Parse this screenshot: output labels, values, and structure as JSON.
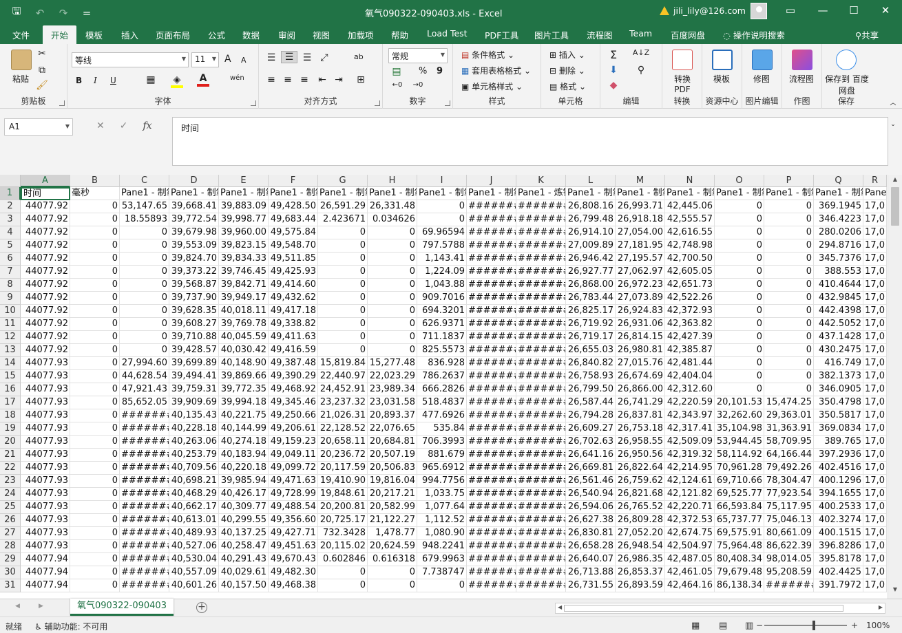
{
  "titlebar": {
    "save_glyph": "🖫",
    "undo_glyph": "↶",
    "redo_glyph": "↷",
    "qat_more": "=",
    "title": "氧气090322-090403.xls  -  Excel",
    "account": "jili_lily@126.com",
    "min": "—",
    "restore": "▭",
    "max": "☐",
    "close": "✕"
  },
  "tabs": [
    "文件",
    "开始",
    "模板",
    "插入",
    "页面布局",
    "公式",
    "数据",
    "审阅",
    "视图",
    "加载项",
    "帮助",
    "Load Test",
    "PDF工具",
    "图片工具",
    "流程图",
    "Team",
    "百度网盘"
  ],
  "tell_me": "操作说明搜索",
  "share": "共享",
  "ribbon": {
    "clipboard": {
      "label": "剪贴板",
      "paste": "粘贴"
    },
    "font": {
      "label": "字体",
      "name": "等线",
      "size": "11",
      "bold": "B",
      "italic": "I",
      "underline": "U",
      "grow": "A",
      "shrink": "A",
      "wen": "wén"
    },
    "align": {
      "label": "对齐方式",
      "wrap": "ab"
    },
    "number": {
      "label": "数字",
      "format": "常规",
      "percent": "%",
      "comma": "9"
    },
    "styles": {
      "label": "样式",
      "cond": "条件格式",
      "table": "套用表格格式",
      "cell": "单元格样式"
    },
    "cells": {
      "label": "单元格",
      "insert": "插入",
      "delete": "删除",
      "format": "格式"
    },
    "editing": {
      "label": "编辑"
    },
    "convert": {
      "label": "转换",
      "btn": "转换 PDF"
    },
    "resource": {
      "label": "资源中心",
      "btn": "模板"
    },
    "picedit": {
      "label": "图片编辑",
      "btn": "修图"
    },
    "draw": {
      "label": "作图",
      "btn": "流程图"
    },
    "save": {
      "label": "保存",
      "btn": "保存到 百度网盘"
    }
  },
  "formula": {
    "namebox": "A1",
    "content": "时间",
    "cancel": "✕",
    "enter": "✓",
    "fx": "fx"
  },
  "columns": [
    "A",
    "B",
    "C",
    "D",
    "E",
    "F",
    "G",
    "H",
    "I",
    "J",
    "K",
    "L",
    "M",
    "N",
    "O",
    "P",
    "Q",
    "R"
  ],
  "rows": [
    [
      "时间",
      "毫秒",
      "Pane1 - 制氧",
      "Pane1 - 制氧",
      "Pane1 - 制氧",
      "Pane1 - 制氧",
      "Pane1 - 制氧",
      "Pane1 - 制氧",
      "Pane1 - 制氧",
      "Pane1 - 制氧",
      "Pane1 - 炼钢",
      "Pane1 - 制氧",
      "Pane1 - 制氧",
      "Pane1 - 制氧",
      "Pane1 - 制氧",
      "Pane1 - 制氧",
      "Pane1 - 制氧",
      "Pane"
    ],
    [
      "44077.92",
      "0",
      "53,147.65",
      "39,668.41",
      "39,883.09",
      "49,428.50",
      "26,591.29",
      "26,331.48",
      "0",
      "#######",
      "#######",
      "26,808.16",
      "26,993.71",
      "42,445.06",
      "0",
      "0",
      "369.1945",
      "17,0"
    ],
    [
      "44077.92",
      "0",
      "18.55893",
      "39,772.54",
      "39,998.77",
      "49,683.44",
      "2.423671",
      "0.034626",
      "0",
      "#######",
      "#######",
      "26,799.48",
      "26,918.18",
      "42,555.57",
      "0",
      "0",
      "346.4223",
      "17,0"
    ],
    [
      "44077.92",
      "0",
      "0",
      "39,679.98",
      "39,960.00",
      "49,575.84",
      "0",
      "0",
      "69.96594",
      "#######",
      "#######",
      "26,914.10",
      "27,054.00",
      "42,616.55",
      "0",
      "0",
      "280.0206",
      "17,0"
    ],
    [
      "44077.92",
      "0",
      "0",
      "39,553.09",
      "39,823.15",
      "49,548.70",
      "0",
      "0",
      "797.5788",
      "#######",
      "#######",
      "27,009.89",
      "27,181.95",
      "42,748.98",
      "0",
      "0",
      "294.8716",
      "17,0"
    ],
    [
      "44077.92",
      "0",
      "0",
      "39,824.70",
      "39,834.33",
      "49,511.85",
      "0",
      "0",
      "1,143.41",
      "#######",
      "#######",
      "26,946.42",
      "27,195.57",
      "42,700.50",
      "0",
      "0",
      "345.7376",
      "17,0"
    ],
    [
      "44077.92",
      "0",
      "0",
      "39,373.22",
      "39,746.45",
      "49,425.93",
      "0",
      "0",
      "1,224.09",
      "#######",
      "#######",
      "26,927.77",
      "27,062.97",
      "42,605.05",
      "0",
      "0",
      "388.553",
      "17,0"
    ],
    [
      "44077.92",
      "0",
      "0",
      "39,568.87",
      "39,842.71",
      "49,414.60",
      "0",
      "0",
      "1,043.88",
      "#######",
      "#######",
      "26,868.00",
      "26,972.23",
      "42,651.73",
      "0",
      "0",
      "410.4644",
      "17,0"
    ],
    [
      "44077.92",
      "0",
      "0",
      "39,737.90",
      "39,949.17",
      "49,432.62",
      "0",
      "0",
      "909.7016",
      "#######",
      "#######",
      "26,783.44",
      "27,073.89",
      "42,522.26",
      "0",
      "0",
      "432.9845",
      "17,0"
    ],
    [
      "44077.92",
      "0",
      "0",
      "39,628.35",
      "40,018.11",
      "49,417.18",
      "0",
      "0",
      "694.3201",
      "#######",
      "#######",
      "26,825.17",
      "26,924.83",
      "42,372.93",
      "0",
      "0",
      "442.4398",
      "17,0"
    ],
    [
      "44077.92",
      "0",
      "0",
      "39,608.27",
      "39,769.78",
      "49,338.82",
      "0",
      "0",
      "626.9371",
      "#######",
      "#######",
      "26,719.92",
      "26,931.06",
      "42,363.82",
      "0",
      "0",
      "442.5052",
      "17,0"
    ],
    [
      "44077.92",
      "0",
      "0",
      "39,710.88",
      "40,045.59",
      "49,411.63",
      "0",
      "0",
      "711.1837",
      "#######",
      "#######",
      "26,719.17",
      "26,814.15",
      "42,427.39",
      "0",
      "0",
      "437.1428",
      "17,0"
    ],
    [
      "44077.92",
      "0",
      "0",
      "39,428.57",
      "40,030.42",
      "49,416.59",
      "0",
      "0",
      "825.5573",
      "#######",
      "#######",
      "26,655.03",
      "26,980.81",
      "42,385.87",
      "0",
      "0",
      "430.2475",
      "17,0"
    ],
    [
      "44077.93",
      "0",
      "27,994.60",
      "39,699.89",
      "40,148.90",
      "49,387.48",
      "15,819.84",
      "15,277.48",
      "836.928",
      "#######",
      "#######",
      "26,840.82",
      "27,015.76",
      "42,481.44",
      "0",
      "0",
      "416.749",
      "17,0"
    ],
    [
      "44077.93",
      "0",
      "44,628.54",
      "39,494.41",
      "39,869.66",
      "49,390.29",
      "22,440.97",
      "22,023.29",
      "786.2637",
      "#######",
      "#######",
      "26,758.93",
      "26,674.69",
      "42,404.04",
      "0",
      "0",
      "382.1373",
      "17,0"
    ],
    [
      "44077.93",
      "0",
      "47,921.43",
      "39,759.31",
      "39,772.35",
      "49,468.92",
      "24,452.91",
      "23,989.34",
      "666.2826",
      "#######",
      "#######",
      "26,799.50",
      "26,866.00",
      "42,312.60",
      "0",
      "0",
      "346.0905",
      "17,0"
    ],
    [
      "44077.93",
      "0",
      "85,652.05",
      "39,909.69",
      "39,994.18",
      "49,345.46",
      "23,237.32",
      "23,031.58",
      "518.4837",
      "#######",
      "#######",
      "26,587.44",
      "26,741.29",
      "42,220.59",
      "20,101.53",
      "15,474.25",
      "350.4798",
      "17,0"
    ],
    [
      "44077.93",
      "0",
      "#######",
      "40,135.43",
      "40,221.75",
      "49,250.66",
      "21,026.31",
      "20,893.37",
      "477.6926",
      "#######",
      "#######",
      "26,794.28",
      "26,837.81",
      "42,343.97",
      "32,262.60",
      "29,363.01",
      "350.5817",
      "17,0"
    ],
    [
      "44077.93",
      "0",
      "#######",
      "40,228.18",
      "40,144.99",
      "49,206.61",
      "22,128.52",
      "22,076.65",
      "535.84",
      "#######",
      "#######",
      "26,609.27",
      "26,753.18",
      "42,317.41",
      "35,104.98",
      "31,363.91",
      "369.0834",
      "17,0"
    ],
    [
      "44077.93",
      "0",
      "#######",
      "40,263.06",
      "40,274.18",
      "49,159.23",
      "20,658.11",
      "20,684.81",
      "706.3993",
      "#######",
      "#######",
      "26,702.63",
      "26,958.55",
      "42,509.09",
      "53,944.45",
      "58,709.95",
      "389.765",
      "17,0"
    ],
    [
      "44077.93",
      "0",
      "#######",
      "40,253.79",
      "40,183.94",
      "49,049.11",
      "20,236.72",
      "20,507.19",
      "881.679",
      "#######",
      "#######",
      "26,641.16",
      "26,950.56",
      "42,319.32",
      "58,114.92",
      "64,166.44",
      "397.2936",
      "17,0"
    ],
    [
      "44077.93",
      "0",
      "#######",
      "40,709.56",
      "40,220.18",
      "49,099.72",
      "20,117.59",
      "20,506.83",
      "965.6912",
      "#######",
      "#######",
      "26,669.81",
      "26,822.64",
      "42,214.95",
      "70,961.28",
      "79,492.26",
      "402.4516",
      "17,0"
    ],
    [
      "44077.93",
      "0",
      "#######",
      "40,698.21",
      "39,985.94",
      "49,471.63",
      "19,410.90",
      "19,816.04",
      "994.7756",
      "#######",
      "#######",
      "26,561.46",
      "26,759.62",
      "42,124.61",
      "69,710.66",
      "78,304.47",
      "400.1296",
      "17,0"
    ],
    [
      "44077.93",
      "0",
      "#######",
      "40,468.29",
      "40,426.17",
      "49,728.99",
      "19,848.61",
      "20,217.21",
      "1,033.75",
      "#######",
      "#######",
      "26,540.94",
      "26,821.68",
      "42,121.82",
      "69,525.77",
      "77,923.54",
      "394.1655",
      "17,0"
    ],
    [
      "44077.93",
      "0",
      "#######",
      "40,662.17",
      "40,309.77",
      "49,488.54",
      "20,200.81",
      "20,582.99",
      "1,077.64",
      "#######",
      "#######",
      "26,594.06",
      "26,765.52",
      "42,220.71",
      "66,593.84",
      "75,117.95",
      "400.2533",
      "17,0"
    ],
    [
      "44077.93",
      "0",
      "#######",
      "40,613.01",
      "40,299.55",
      "49,356.60",
      "20,725.17",
      "21,122.27",
      "1,112.52",
      "#######",
      "#######",
      "26,627.38",
      "26,809.28",
      "42,372.53",
      "65,737.77",
      "75,046.13",
      "402.3274",
      "17,0"
    ],
    [
      "44077.93",
      "0",
      "#######",
      "40,489.93",
      "40,137.25",
      "49,427.71",
      "732.3428",
      "1,478.77",
      "1,080.90",
      "#######",
      "#######",
      "26,830.81",
      "27,052.20",
      "42,674.75",
      "69,575.91",
      "80,661.09",
      "400.1515",
      "17,0"
    ],
    [
      "44077.93",
      "0",
      "#######",
      "40,527.06",
      "40,258.47",
      "49,451.63",
      "20,115.02",
      "20,624.59",
      "948.2241",
      "#######",
      "#######",
      "26,658.28",
      "26,948.54",
      "42,504.97",
      "75,964.48",
      "86,622.39",
      "396.8286",
      "17,0"
    ],
    [
      "44077.94",
      "0",
      "#######",
      "40,530.04",
      "40,291.43",
      "49,670.43",
      "0.602846",
      "0.616318",
      "679.9963",
      "#######",
      "#######",
      "26,640.07",
      "26,986.35",
      "42,487.05",
      "80,408.34",
      "98,014.05",
      "395.8178",
      "17,0"
    ],
    [
      "44077.94",
      "0",
      "#######",
      "40,557.09",
      "40,029.61",
      "49,482.30",
      "0",
      "0",
      "7.738747",
      "#######",
      "#######",
      "26,713.88",
      "26,853.37",
      "42,461.05",
      "79,679.48",
      "95,208.59",
      "402.4425",
      "17,0"
    ],
    [
      "44077.94",
      "0",
      "#######",
      "40,601.26",
      "40,157.50",
      "49,468.38",
      "0",
      "0",
      "0",
      "#######",
      "#######",
      "26,731.55",
      "26,893.59",
      "42,464.16",
      "86,138.34",
      "#######",
      "391.7972",
      "17,0"
    ]
  ],
  "sheet": {
    "name": "氧气090322-090403",
    "add": "+",
    "prev": "◀",
    "next": "▶"
  },
  "status": {
    "ready": "就绪",
    "accessibility": "辅助功能: 不可用",
    "zoom": "100%",
    "minus": "−",
    "plus": "+"
  }
}
